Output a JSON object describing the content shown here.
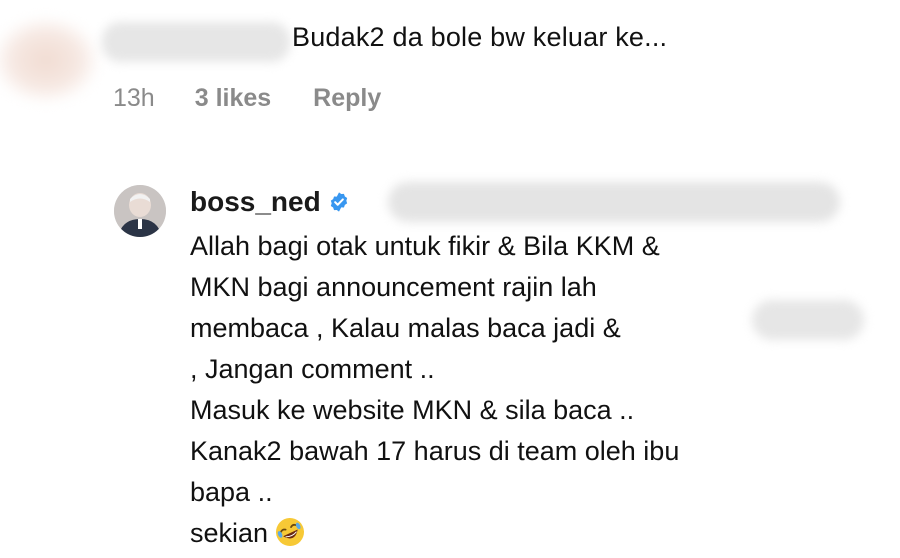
{
  "comment": {
    "text": "Budak2 da bole bw keluar ke...",
    "time": "13h",
    "likes": "3 likes",
    "reply_label": "Reply"
  },
  "reply": {
    "username": "boss_ned",
    "verified": true,
    "lines": [
      "Allah bagi otak untuk fikir & Bila KKM &",
      "MKN bagi announcement rajin lah",
      "membaca , Kalau malas baca jadi &",
      ", Jangan comment ..",
      "Masuk ke website MKN & sila baca ..",
      "Kanak2 bawah 17 harus di team oleh ibu",
      "bapa ..",
      "sekian"
    ],
    "emoji": "rolling-on-floor-laughing"
  },
  "colors": {
    "text": "#111111",
    "meta": "#8a8a8a",
    "verified_blue": "#3897f0"
  }
}
